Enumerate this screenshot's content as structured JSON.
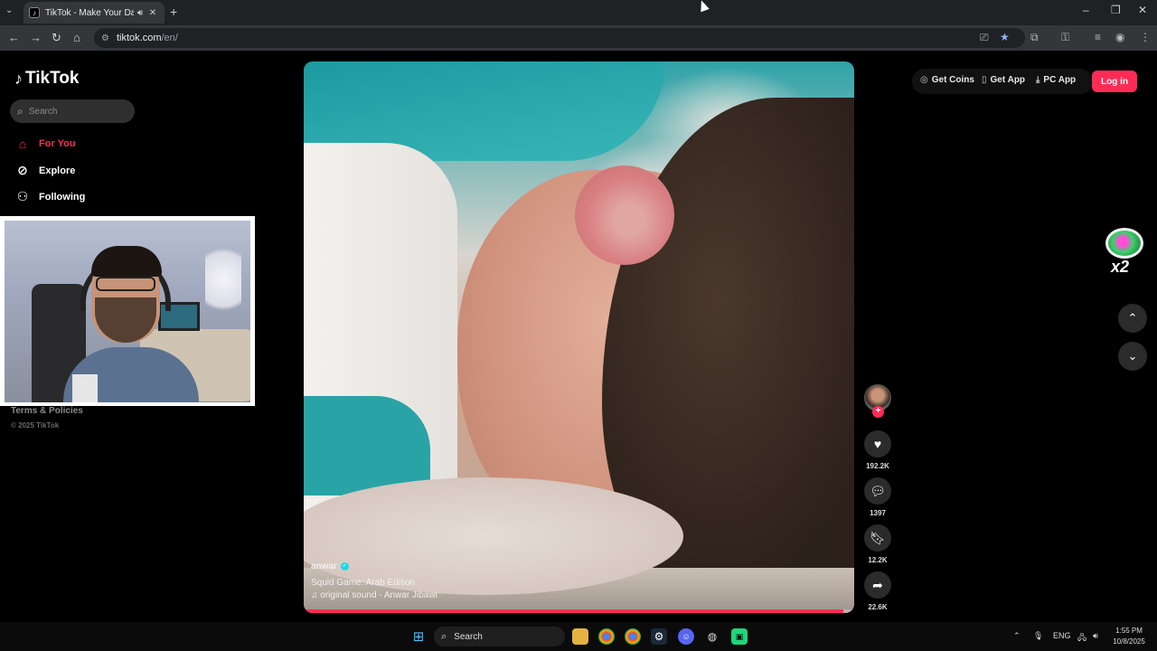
{
  "browser": {
    "tab_title": "TikTok - Make Your Day",
    "url_host": "tiktok.com",
    "url_path": "/en/"
  },
  "sidebar": {
    "logo": "TikTok",
    "search_placeholder": "Search",
    "nav": [
      {
        "label": "For You",
        "icon": "home-icon",
        "active": true
      },
      {
        "label": "Explore",
        "icon": "compass-icon",
        "active": false
      },
      {
        "label": "Following",
        "icon": "user-icon",
        "active": false
      }
    ],
    "legal": "Terms & Policies",
    "copyright": "© 2025 TikTok"
  },
  "header": {
    "get_coins": "Get Coins",
    "get_app": "Get App",
    "pc_app": "PC App",
    "login": "Log in"
  },
  "video": {
    "author": "anwar",
    "verified": true,
    "description": "Squid Game: Arab Edition",
    "sound": "original sound - Anwar Jibawi",
    "progress": 0.98
  },
  "actions": {
    "likes": "192.2K",
    "comments": "1397",
    "saves": "12.2K",
    "shares": "22.6K"
  },
  "promo": {
    "multiplier": "x2"
  },
  "taskbar": {
    "search": "Search",
    "lang": "ENG",
    "time": "1:55 PM",
    "date": "10/8/2025"
  },
  "colors": {
    "accent": "#fe2c55",
    "verified": "#20d5ec"
  }
}
